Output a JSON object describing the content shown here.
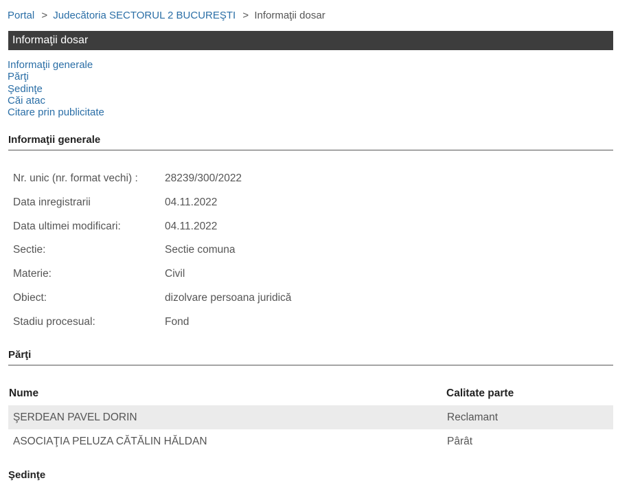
{
  "breadcrumb": {
    "portal": "Portal",
    "separator": ">",
    "court": "Judecătoria SECTORUL 2 BUCUREŞTI",
    "current": "Informaţii dosar"
  },
  "title_bar": "Informaţii dosar",
  "toc": [
    "Informaţii generale",
    "Părţi",
    "Şedinţe",
    "Căi atac",
    "Citare prin publicitate"
  ],
  "general": {
    "heading": "Informaţii generale",
    "rows": [
      {
        "label": "Nr. unic (nr. format vechi) :",
        "value": "28239/300/2022"
      },
      {
        "label": "Data inregistrarii",
        "value": "04.11.2022"
      },
      {
        "label": "Data ultimei modificari:",
        "value": "04.11.2022"
      },
      {
        "label": "Sectie:",
        "value": "Sectie comuna"
      },
      {
        "label": "Materie:",
        "value": "Civil"
      },
      {
        "label": "Obiect:",
        "value": "dizolvare persoana juridică"
      },
      {
        "label": "Stadiu procesual:",
        "value": "Fond"
      }
    ]
  },
  "parties": {
    "heading": "Părţi",
    "columns": [
      "Nume",
      "Calitate parte"
    ],
    "rows": [
      {
        "name": "ŞERDEAN PAVEL DORIN",
        "role": "Reclamant"
      },
      {
        "name": "ASOCIAŢIA PELUZA CĂTĂLIN HĂLDAN",
        "role": "Pârât"
      }
    ]
  },
  "hearings": {
    "heading": "Şedinţe"
  }
}
